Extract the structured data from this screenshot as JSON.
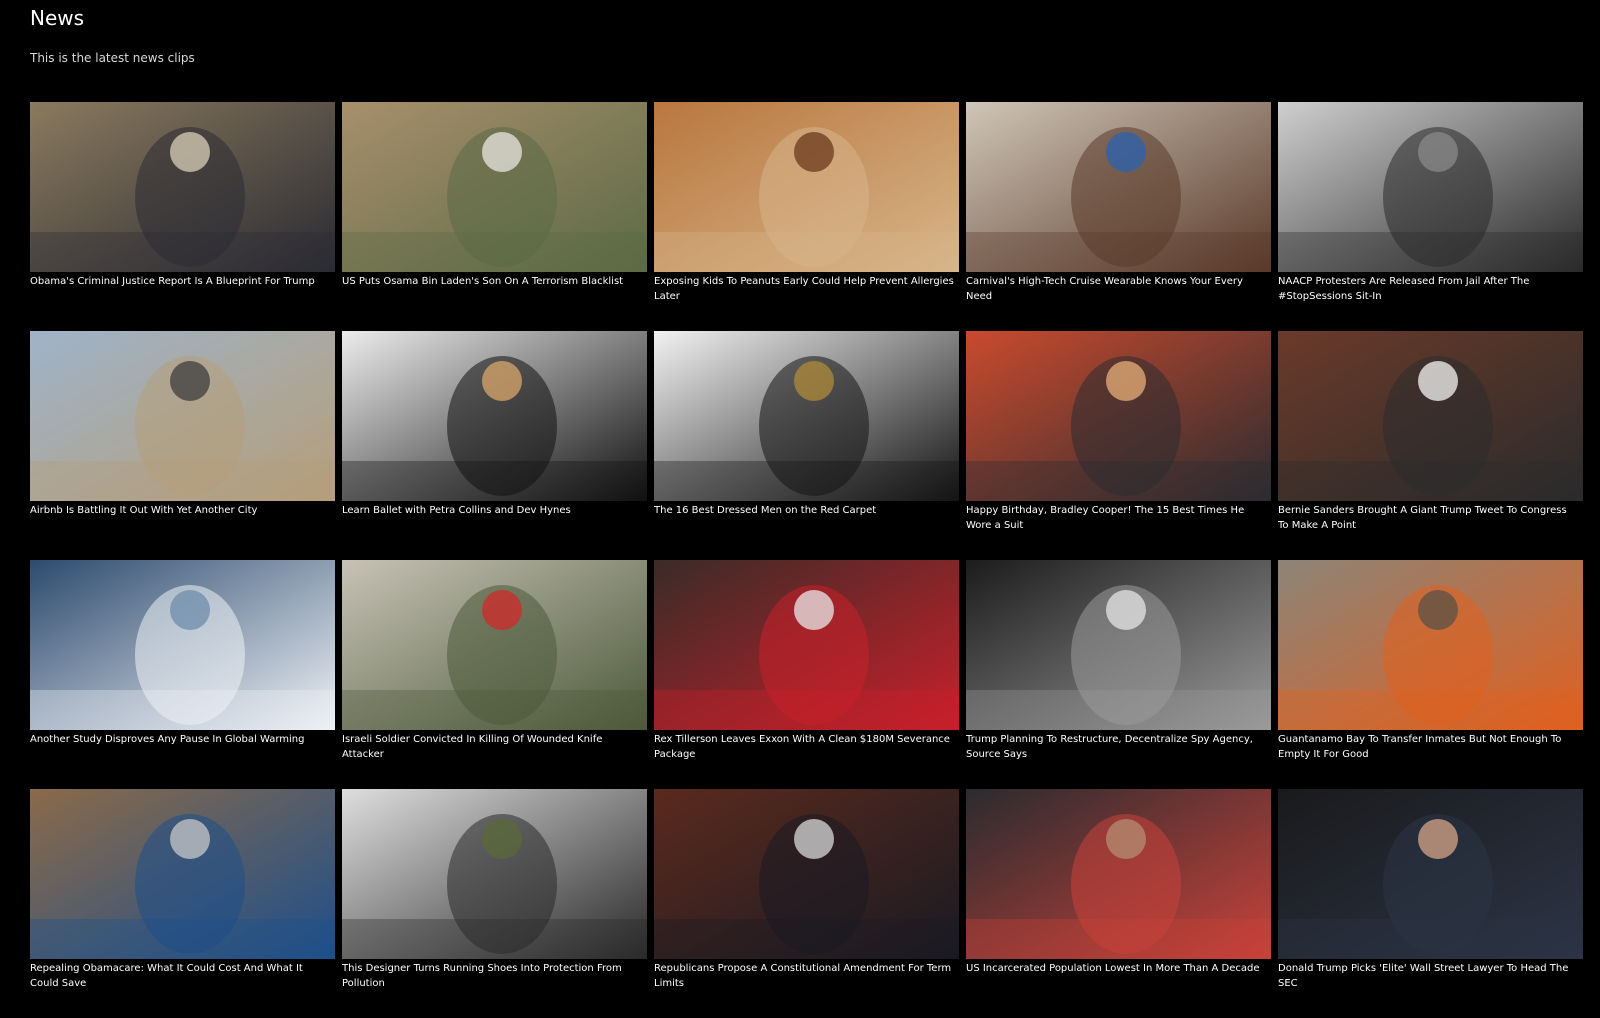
{
  "header": {
    "title": "News",
    "subtitle": "This is the latest news clips"
  },
  "clips": [
    {
      "caption": "Obama's Criminal Justice Report Is A Blueprint For Trump",
      "icon": "oval-office-meeting-thumbnail",
      "colors": [
        "#8a7a5e",
        "#2b2b33",
        "#d9cfb8"
      ]
    },
    {
      "caption": "US Puts Osama Bin Laden's Son On A Terrorism Blacklist",
      "icon": "desert-camp-thumbnail",
      "colors": [
        "#a88f6c",
        "#5b6a45",
        "#e8e6e0"
      ]
    },
    {
      "caption": "Exposing Kids To Peanuts Early Could Help Prevent Allergies Later",
      "icon": "peanuts-jar-thumbnail",
      "colors": [
        "#b9773f",
        "#d7b58a",
        "#6b3a1c"
      ]
    },
    {
      "caption": "Carnival's High-Tech Cruise Wearable Knows Your Every Need",
      "icon": "wearable-watch-thumbnail",
      "colors": [
        "#cfc6b7",
        "#5a3a2a",
        "#2a62b0"
      ]
    },
    {
      "caption": "NAACP Protesters Are Released From Jail After The #StopSessions Sit-In",
      "icon": "mugshots-thumbnail",
      "colors": [
        "#cfcfcf",
        "#2a2a2a",
        "#8a8a8a"
      ]
    },
    {
      "caption": "Airbnb Is Battling It Out With Yet Another City",
      "icon": "eiffel-tower-thumbnail",
      "colors": [
        "#9fb3c8",
        "#b59e7a",
        "#3d3d3d"
      ]
    },
    {
      "caption": "Learn Ballet with Petra Collins and Dev Hynes",
      "icon": "ballet-piano-thumbnail",
      "colors": [
        "#ececec",
        "#111111",
        "#d9a66a"
      ]
    },
    {
      "caption": "The 16 Best Dressed Men on the Red Carpet",
      "icon": "oscars-tuxedo-thumbnail",
      "colors": [
        "#f2f2f2",
        "#141414",
        "#b08a3a"
      ]
    },
    {
      "caption": "Happy Birthday, Bradley Cooper! The 15 Best Times He Wore a Suit",
      "icon": "red-carpet-suit-thumbnail",
      "colors": [
        "#c94a2e",
        "#2c2c30",
        "#e8b07a"
      ]
    },
    {
      "caption": "Bernie Sanders Brought A Giant Trump Tweet To Congress To Make A Point",
      "icon": "senate-tweet-thumbnail",
      "colors": [
        "#6a3a2a",
        "#2b2b2b",
        "#f5f5f5"
      ]
    },
    {
      "caption": "Another Study Disproves Any Pause In Global Warming",
      "icon": "icebergs-thumbnail",
      "colors": [
        "#2d4a6e",
        "#eef2f6",
        "#6f8cab"
      ]
    },
    {
      "caption": "Israeli Soldier Convicted In Killing Of Wounded Knife Attacker",
      "icon": "ambulance-street-thumbnail",
      "colors": [
        "#c7c2b6",
        "#4d5a3a",
        "#d22a2a"
      ]
    },
    {
      "caption": "Rex Tillerson Leaves Exxon With A Clean $180M Severance Package",
      "icon": "exxonmobil-podium-thumbnail",
      "colors": [
        "#3a2b28",
        "#c8202a",
        "#e9e9e9"
      ]
    },
    {
      "caption": "Trump Planning To Restructure, Decentralize Spy Agency, Source Says",
      "icon": "cia-seal-floor-thumbnail",
      "colors": [
        "#1c1c1c",
        "#9a9a9a",
        "#e6e6e6"
      ]
    },
    {
      "caption": "Guantanamo Bay To Transfer Inmates But Not Enough To Empty It For Good",
      "icon": "prison-fence-thumbnail",
      "colors": [
        "#8c8478",
        "#e0601f",
        "#5a5247"
      ]
    },
    {
      "caption": "Repealing Obamacare: What It Could Cost And What It Could Save",
      "icon": "laptop-healthcare-thumbnail",
      "colors": [
        "#8a6a4a",
        "#1e4f8a",
        "#c8c8c8"
      ]
    },
    {
      "caption": "This Designer Turns Running Shoes Into Protection From Pollution",
      "icon": "pollution-mask-thumbnail",
      "colors": [
        "#dedede",
        "#2a2a2a",
        "#5a6a3a"
      ]
    },
    {
      "caption": "Republicans Propose A Constitutional Amendment For Term Limits",
      "icon": "congress-chamber-thumbnail",
      "colors": [
        "#5a2a1e",
        "#1a1a22",
        "#d9d9d9"
      ]
    },
    {
      "caption": "US Incarcerated Population Lowest In More Than A Decade",
      "icon": "flag-illustration-thumbnail",
      "colors": [
        "#2b2b2f",
        "#c8423a",
        "#b48e72"
      ]
    },
    {
      "caption": "Donald Trump Picks 'Elite' Wall Street Lawyer To Head The SEC",
      "icon": "suited-man-portrait-thumbnail",
      "colors": [
        "#1a1a1c",
        "#2c3445",
        "#d7a58a"
      ]
    }
  ]
}
